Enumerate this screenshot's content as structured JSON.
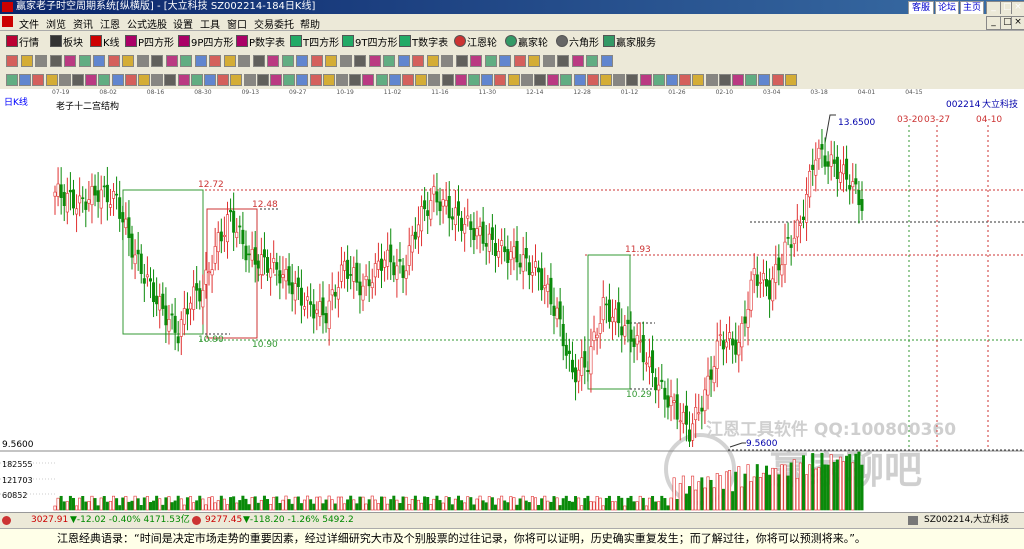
{
  "window": {
    "title": "赢家老子时空周期系统[纵横版] - [大立科技  SZ002214-184日K线]",
    "title_buttons": [
      "客服",
      "论坛",
      "主页"
    ],
    "controls": [
      "_",
      "□",
      "×"
    ]
  },
  "menu": [
    "文件",
    "浏览",
    "资讯",
    "江恩",
    "公式选股",
    "设置",
    "工具",
    "窗口",
    "交易委托",
    "帮助"
  ],
  "toolbar_main": [
    "行情",
    "板块",
    "K线",
    "P四方形",
    "9P四方形",
    "P数字表",
    "T四方形",
    "9T四方形",
    "T数字表",
    "江恩轮",
    "赢家轮",
    "六角形",
    "赢家服务"
  ],
  "date_axis": [
    "07-19",
    "08-02",
    "08-16",
    "08-30",
    "09-13",
    "09-27",
    "10-19",
    "11-02",
    "11-16",
    "11-30",
    "12-14",
    "12-28",
    "01-12",
    "01-26",
    "02-10",
    "03-04",
    "03-18",
    "04-01",
    "04-15"
  ],
  "chart": {
    "period_label": "日K线",
    "study_name": "老子十二宫结构",
    "stock_code": "002214",
    "stock_name": "大立科技",
    "label_1272": "12.72",
    "label_1248": "12.48",
    "label_1193": "11.93",
    "label_1090a": "10.90",
    "label_1090b": "10.90",
    "label_1029": "10.29",
    "label_high": "13.6500",
    "label_low": "9.5600",
    "label_low_axis": "9.5600",
    "date_marks": [
      "03-20",
      "03-27",
      "04-10"
    ],
    "watermark_soft": "江恩工具软件  QQ:100800360",
    "watermark_big": "赢家聊吧",
    "vol_labels": [
      "182555",
      "121703",
      "60852"
    ]
  },
  "chart_data": {
    "type": "candlestick",
    "high": 13.65,
    "low": 9.56,
    "levels": [
      12.72,
      12.48,
      11.93,
      10.9,
      10.9,
      10.29
    ],
    "volume_ticks": [
      182555,
      121703,
      60852
    ]
  },
  "status": {
    "sh_index": "3027.91",
    "sh_change": "▼-12.02 -0.40% 4171.53亿",
    "sz_index": "9277.45",
    "sz_change": "▼-118.20 -1.26% 5492.2",
    "right_info": "SZ002214,大立科技"
  },
  "quote": "江恩经典语录：“时间是决定市场走势的重要因素，经过详细研究大市及个别股票的过往记录，你将可以证明，历史确实重复发生；而了解过往，你将可以预测将来。”。"
}
